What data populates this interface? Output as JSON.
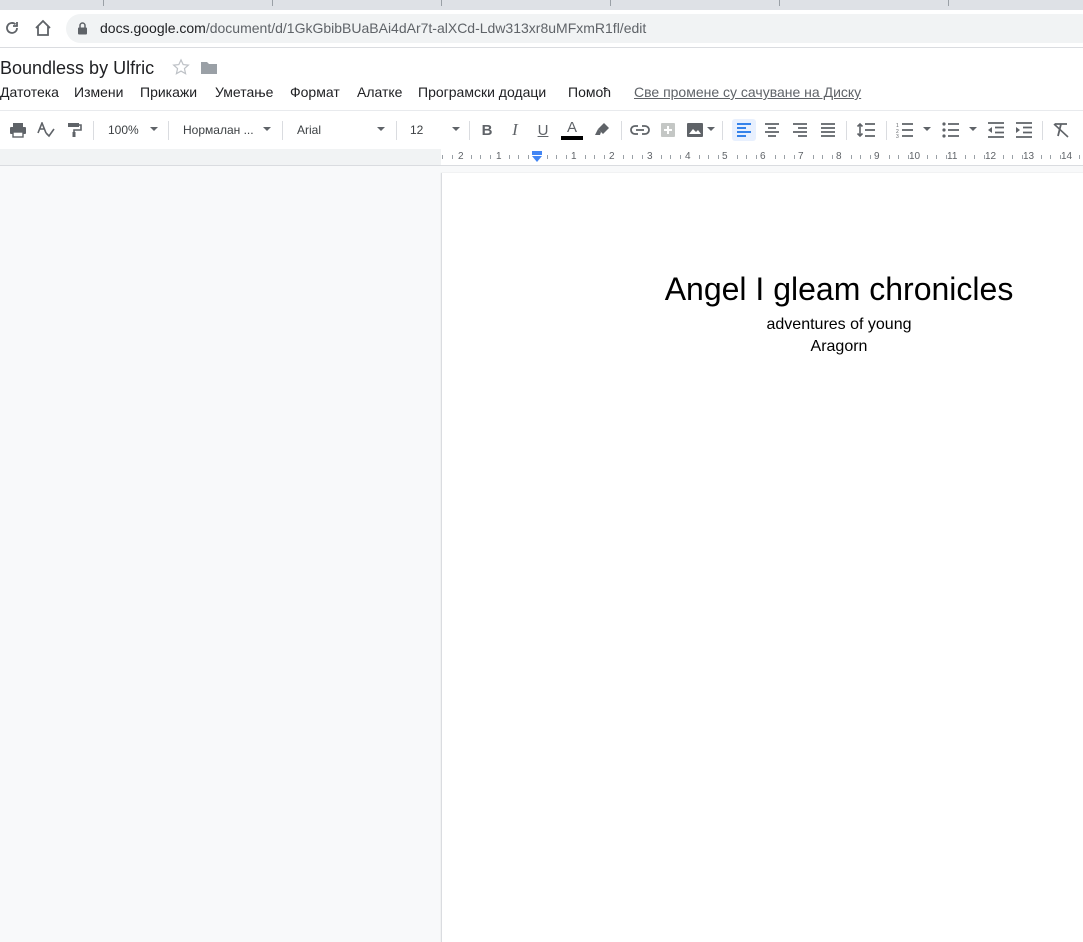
{
  "browser": {
    "url_host": "docs.google.com",
    "url_path": "/document/d/1GkGbibBUaBAi4dAr7t-alXCd-Ldw313xr8uMFxmR1fl/edit"
  },
  "doc": {
    "title": "Boundless by Ulfric",
    "saved_status": "Све промене су сачуване на Диску"
  },
  "menu": [
    "Датотека",
    "Измени",
    "Прикажи",
    "Уметање",
    "Формат",
    "Алатке",
    "Програмски додаци",
    "Помоћ"
  ],
  "toolbar": {
    "zoom": "100%",
    "style": "Нормалан ...",
    "font": "Arial",
    "font_size": "12",
    "bold_glyph": "B",
    "italic_glyph": "I",
    "underline_glyph": "U",
    "text_color_glyph": "A",
    "text_color": "#000000",
    "active_alignment": "align-left"
  },
  "ruler": {
    "labels": [
      "2",
      "1",
      "1",
      "2",
      "3",
      "4",
      "5",
      "6",
      "7",
      "8",
      "9",
      "10",
      "11",
      "12",
      "13",
      "14"
    ]
  },
  "document": {
    "heading": "Angel I gleam chronicles",
    "subtitle_line1": "adventures of young",
    "subtitle_line2": "Aragorn"
  },
  "colors": {
    "accent": "#1a73e8",
    "active_bg": "#e8f0fe"
  }
}
